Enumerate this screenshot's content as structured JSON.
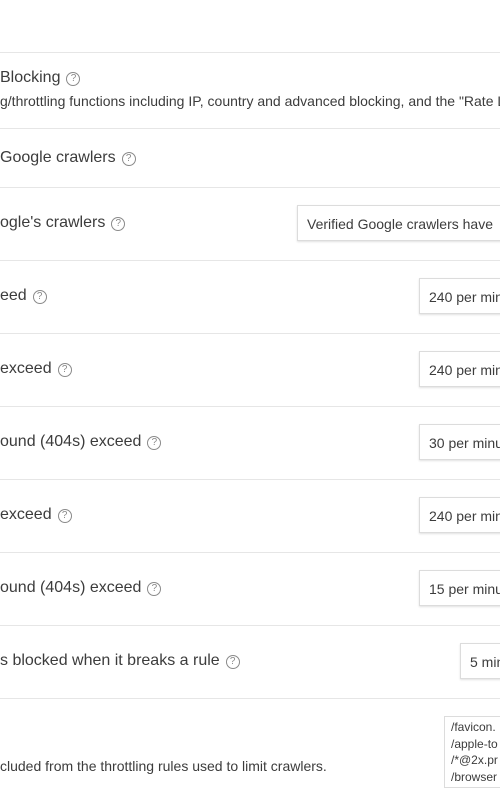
{
  "section": {
    "title": "Blocking",
    "description": "g/throttling functions including IP, country and advanced blocking, and the \"Rate Lim"
  },
  "help_glyph": "?",
  "rows": [
    {
      "label": "Google crawlers"
    },
    {
      "label": "ogle's crawlers",
      "value": "Verified Google crawlers have"
    },
    {
      "label": "eed",
      "value": "240 per min"
    },
    {
      "label": "exceed",
      "value": "240 per min"
    },
    {
      "label": "ound (404s) exceed",
      "value": "30 per minu"
    },
    {
      "label": "exceed",
      "value": "240 per min"
    },
    {
      "label": "ound (404s) exceed",
      "value": "15 per minu"
    },
    {
      "label": "s blocked when it breaks a rule",
      "value": "5 min"
    }
  ],
  "exclusions": {
    "description": "cluded from the throttling rules used to limit crawlers.",
    "lines": [
      "/favicon.",
      "/apple-to",
      "/*@2x.pr",
      "/browser"
    ]
  }
}
